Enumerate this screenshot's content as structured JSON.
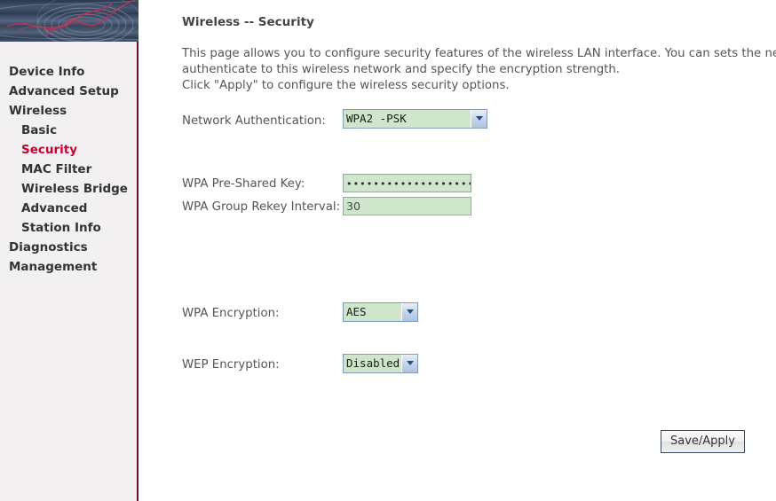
{
  "sidebar": {
    "items": [
      {
        "label": "Device Info",
        "level": 1,
        "active": false
      },
      {
        "label": "Advanced Setup",
        "level": 1,
        "active": false
      },
      {
        "label": "Wireless",
        "level": 1,
        "active": false
      },
      {
        "label": "Basic",
        "level": 2,
        "active": false
      },
      {
        "label": "Security",
        "level": 2,
        "active": true
      },
      {
        "label": "MAC Filter",
        "level": 2,
        "active": false
      },
      {
        "label": "Wireless Bridge",
        "level": 2,
        "active": false
      },
      {
        "label": "Advanced",
        "level": 2,
        "active": false
      },
      {
        "label": "Station Info",
        "level": 2,
        "active": false
      },
      {
        "label": "Diagnostics",
        "level": 1,
        "active": false
      },
      {
        "label": "Management",
        "level": 1,
        "active": false
      }
    ],
    "active_color": "#cc0033",
    "divider_color": "#6d0b2c",
    "background_color": "#f2f0f0"
  },
  "banner": {
    "base_color": "#3a4a63",
    "accent_color": "#c0375a"
  },
  "main": {
    "title": "Wireless -- Security",
    "description_line1": "This page allows you to configure security features of the wireless LAN interface. You can sets the network authentic",
    "description_line2": "authenticate to this wireless network and specify the encryption strength.",
    "description_line3": "Click \"Apply\" to configure the wireless security options.",
    "fields": {
      "network_authentication": {
        "label": "Network Authentication:",
        "value": "WPA2 -PSK"
      },
      "wpa_preshared_key": {
        "label": "WPA Pre-Shared Key:",
        "value": "••••••••••••••••••••",
        "placeholder": ""
      },
      "wpa_group_rekey_interval": {
        "label": "WPA Group Rekey Interval:",
        "value": "30",
        "placeholder": ""
      },
      "wpa_encryption": {
        "label": "WPA Encryption:",
        "value": "AES"
      },
      "wep_encryption": {
        "label": "WEP Encryption:",
        "value": "Disabled"
      }
    },
    "save_button": "Save/Apply",
    "field_background_color": "#cfe6cc"
  }
}
